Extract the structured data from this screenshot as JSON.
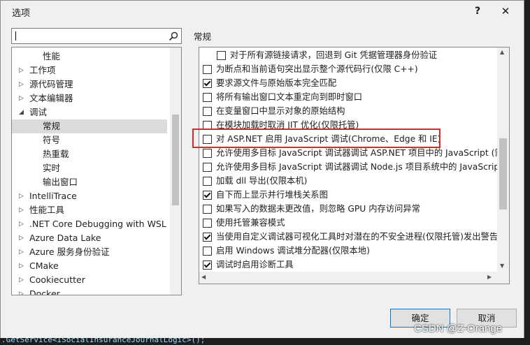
{
  "dialog": {
    "title": "选项",
    "help": "?",
    "close": "✕"
  },
  "search": {
    "value": ""
  },
  "tree": [
    {
      "label": "性能",
      "indent": 2,
      "arrow": ""
    },
    {
      "label": "工作项",
      "indent": 1,
      "arrow": "▷"
    },
    {
      "label": "源代码管理",
      "indent": 1,
      "arrow": "▷"
    },
    {
      "label": "文本编辑器",
      "indent": 1,
      "arrow": "▷"
    },
    {
      "label": "调试",
      "indent": 1,
      "arrow": "◢"
    },
    {
      "label": "常规",
      "indent": 2,
      "arrow": "",
      "selected": true
    },
    {
      "label": "符号",
      "indent": 2,
      "arrow": ""
    },
    {
      "label": "热重载",
      "indent": 2,
      "arrow": ""
    },
    {
      "label": "实时",
      "indent": 2,
      "arrow": ""
    },
    {
      "label": "输出窗口",
      "indent": 2,
      "arrow": ""
    },
    {
      "label": "IntelliTrace",
      "indent": 1,
      "arrow": "▷"
    },
    {
      "label": "性能工具",
      "indent": 1,
      "arrow": "▷"
    },
    {
      "label": ".NET Core Debugging with WSL",
      "indent": 1,
      "arrow": "▷"
    },
    {
      "label": "Azure Data Lake",
      "indent": 1,
      "arrow": "▷"
    },
    {
      "label": "Azure 服务身份验证",
      "indent": 1,
      "arrow": "▷"
    },
    {
      "label": "CMake",
      "indent": 1,
      "arrow": "▷"
    },
    {
      "label": "Cookiecutter",
      "indent": 1,
      "arrow": "▷"
    },
    {
      "label": "Docker",
      "indent": 1,
      "arrow": "▷"
    }
  ],
  "section_title": "常规",
  "options": [
    {
      "label": "对于所有源链接请求，回退到 Git 凭据管理器身份验证",
      "checked": false,
      "indent": true
    },
    {
      "label": "为断点和当前语句突出显示整个源代码行(仅限 C++)",
      "checked": false
    },
    {
      "label": "要求源文件与原始版本完全匹配",
      "checked": true
    },
    {
      "label": "将所有输出窗口文本重定向到即时窗口",
      "checked": false
    },
    {
      "label": "在变量窗口中显示对象的原始结构",
      "checked": false
    },
    {
      "label": "在模块加载时取消 JIT 优化(仅限托管)",
      "checked": false
    },
    {
      "label": "对 ASP.NET 启用 JavaScript 调试(Chrome、Edge 和 IE)",
      "checked": false
    },
    {
      "label": "允许使用多目标 JavaScript 调试器调试 ASP.NET 项目中的 JavaScript (需要",
      "checked": false
    },
    {
      "label": "允许使用多目标 JavaScript 调试器调试 Node.js 项目系统中的 JavaScript (",
      "checked": false
    },
    {
      "label": "加载 dll 导出(仅限本机)",
      "checked": false
    },
    {
      "label": "自下而上显示并行堆栈关系图",
      "checked": true
    },
    {
      "label": "如果写入的数据未更改值，则忽略 GPU 内存访问异常",
      "checked": false
    },
    {
      "label": "使用托管兼容模式",
      "checked": false
    },
    {
      "label": "当使用自定义调试器可视化工具时对潜在的不安全进程(仅限托管)发出警告",
      "checked": true
    },
    {
      "label": "启用 Windows 调试堆分配器(仅限本地)",
      "checked": false
    },
    {
      "label": "调试时启用诊断工具",
      "checked": true
    }
  ],
  "buttons": {
    "ok": "确定",
    "cancel": "取消"
  },
  "watermark": "CSDN @Z-Orange",
  "code_line": ".GetService<ISocialInsuranceJournalLogic>();",
  "colors": {
    "highlight": "#e0242a",
    "accent": "#0078d7"
  }
}
